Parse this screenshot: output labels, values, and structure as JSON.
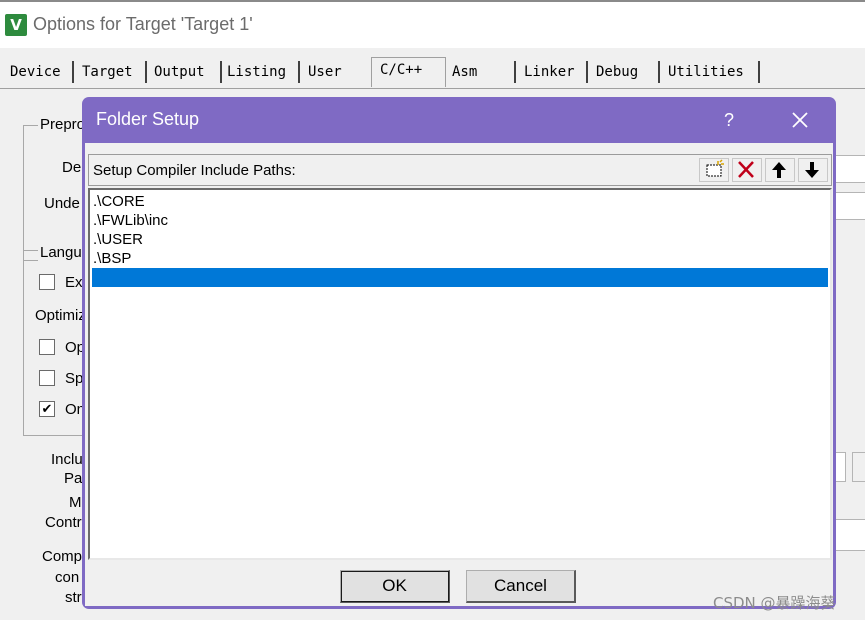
{
  "window": {
    "icon_glyph": "V",
    "title": "Options for Target 'Target 1'"
  },
  "tabs": [
    "Device",
    "Target",
    "Output",
    "Listing",
    "User",
    "C/C++",
    "Asm",
    "Linker",
    "Debug",
    "Utilities"
  ],
  "active_tab": "C/C++",
  "background": {
    "labels": [
      "Prepro",
      "De",
      "Unde",
      "Langu",
      "Ex",
      "Optimiz",
      "Op",
      "Sp",
      "On",
      "Inclu",
      "Pa",
      "M",
      "Contr",
      "Comp",
      "con",
      "str"
    ],
    "checkbox_states": {
      "Ex": false,
      "Op": false,
      "Sp": false,
      "On": true
    }
  },
  "dialog": {
    "title": "Folder Setup",
    "help_glyph": "?",
    "list_header": "Setup Compiler Include Paths:",
    "toolbar": {
      "new_icon": "new-folder-icon",
      "delete_icon": "delete-icon",
      "up_icon": "move-up-icon",
      "down_icon": "move-down-icon"
    },
    "paths": [
      ".\\CORE",
      ".\\FWLib\\inc",
      ".\\USER",
      ".\\BSP",
      ""
    ],
    "selected_index": 4,
    "ok_label": "OK",
    "cancel_label": "Cancel"
  },
  "colors": {
    "dialog_frame": "#7f6ac4",
    "selection": "#0078d7"
  },
  "watermark": "CSDN @暴躁海葵"
}
